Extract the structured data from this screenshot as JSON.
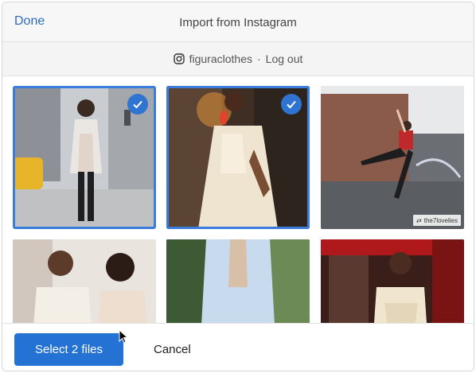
{
  "header": {
    "done_label": "Done",
    "title": "Import from Instagram"
  },
  "account": {
    "icon": "instagram-icon",
    "username": "figuraclothes",
    "separator": "·",
    "logout_label": "Log out"
  },
  "photos": [
    {
      "id": "photo-1",
      "selected": true,
      "description": "street fashion, white coat"
    },
    {
      "id": "photo-2",
      "selected": true,
      "description": "woman in cream dress, red earrings"
    },
    {
      "id": "photo-3",
      "selected": false,
      "description": "dancer jumping by fountain",
      "watermark": "the7lovelies"
    },
    {
      "id": "photo-4",
      "selected": false,
      "description": "two women in white tops"
    },
    {
      "id": "photo-5",
      "selected": false,
      "description": "woman in light blue shirt"
    },
    {
      "id": "photo-6",
      "selected": false,
      "description": "woman in cream top, red interior"
    }
  ],
  "footer": {
    "select_label": "Select 2 files",
    "cancel_label": "Cancel"
  },
  "colors": {
    "accent": "#2472d4",
    "link": "#2d6dbd",
    "selection": "#3b7ddd"
  }
}
